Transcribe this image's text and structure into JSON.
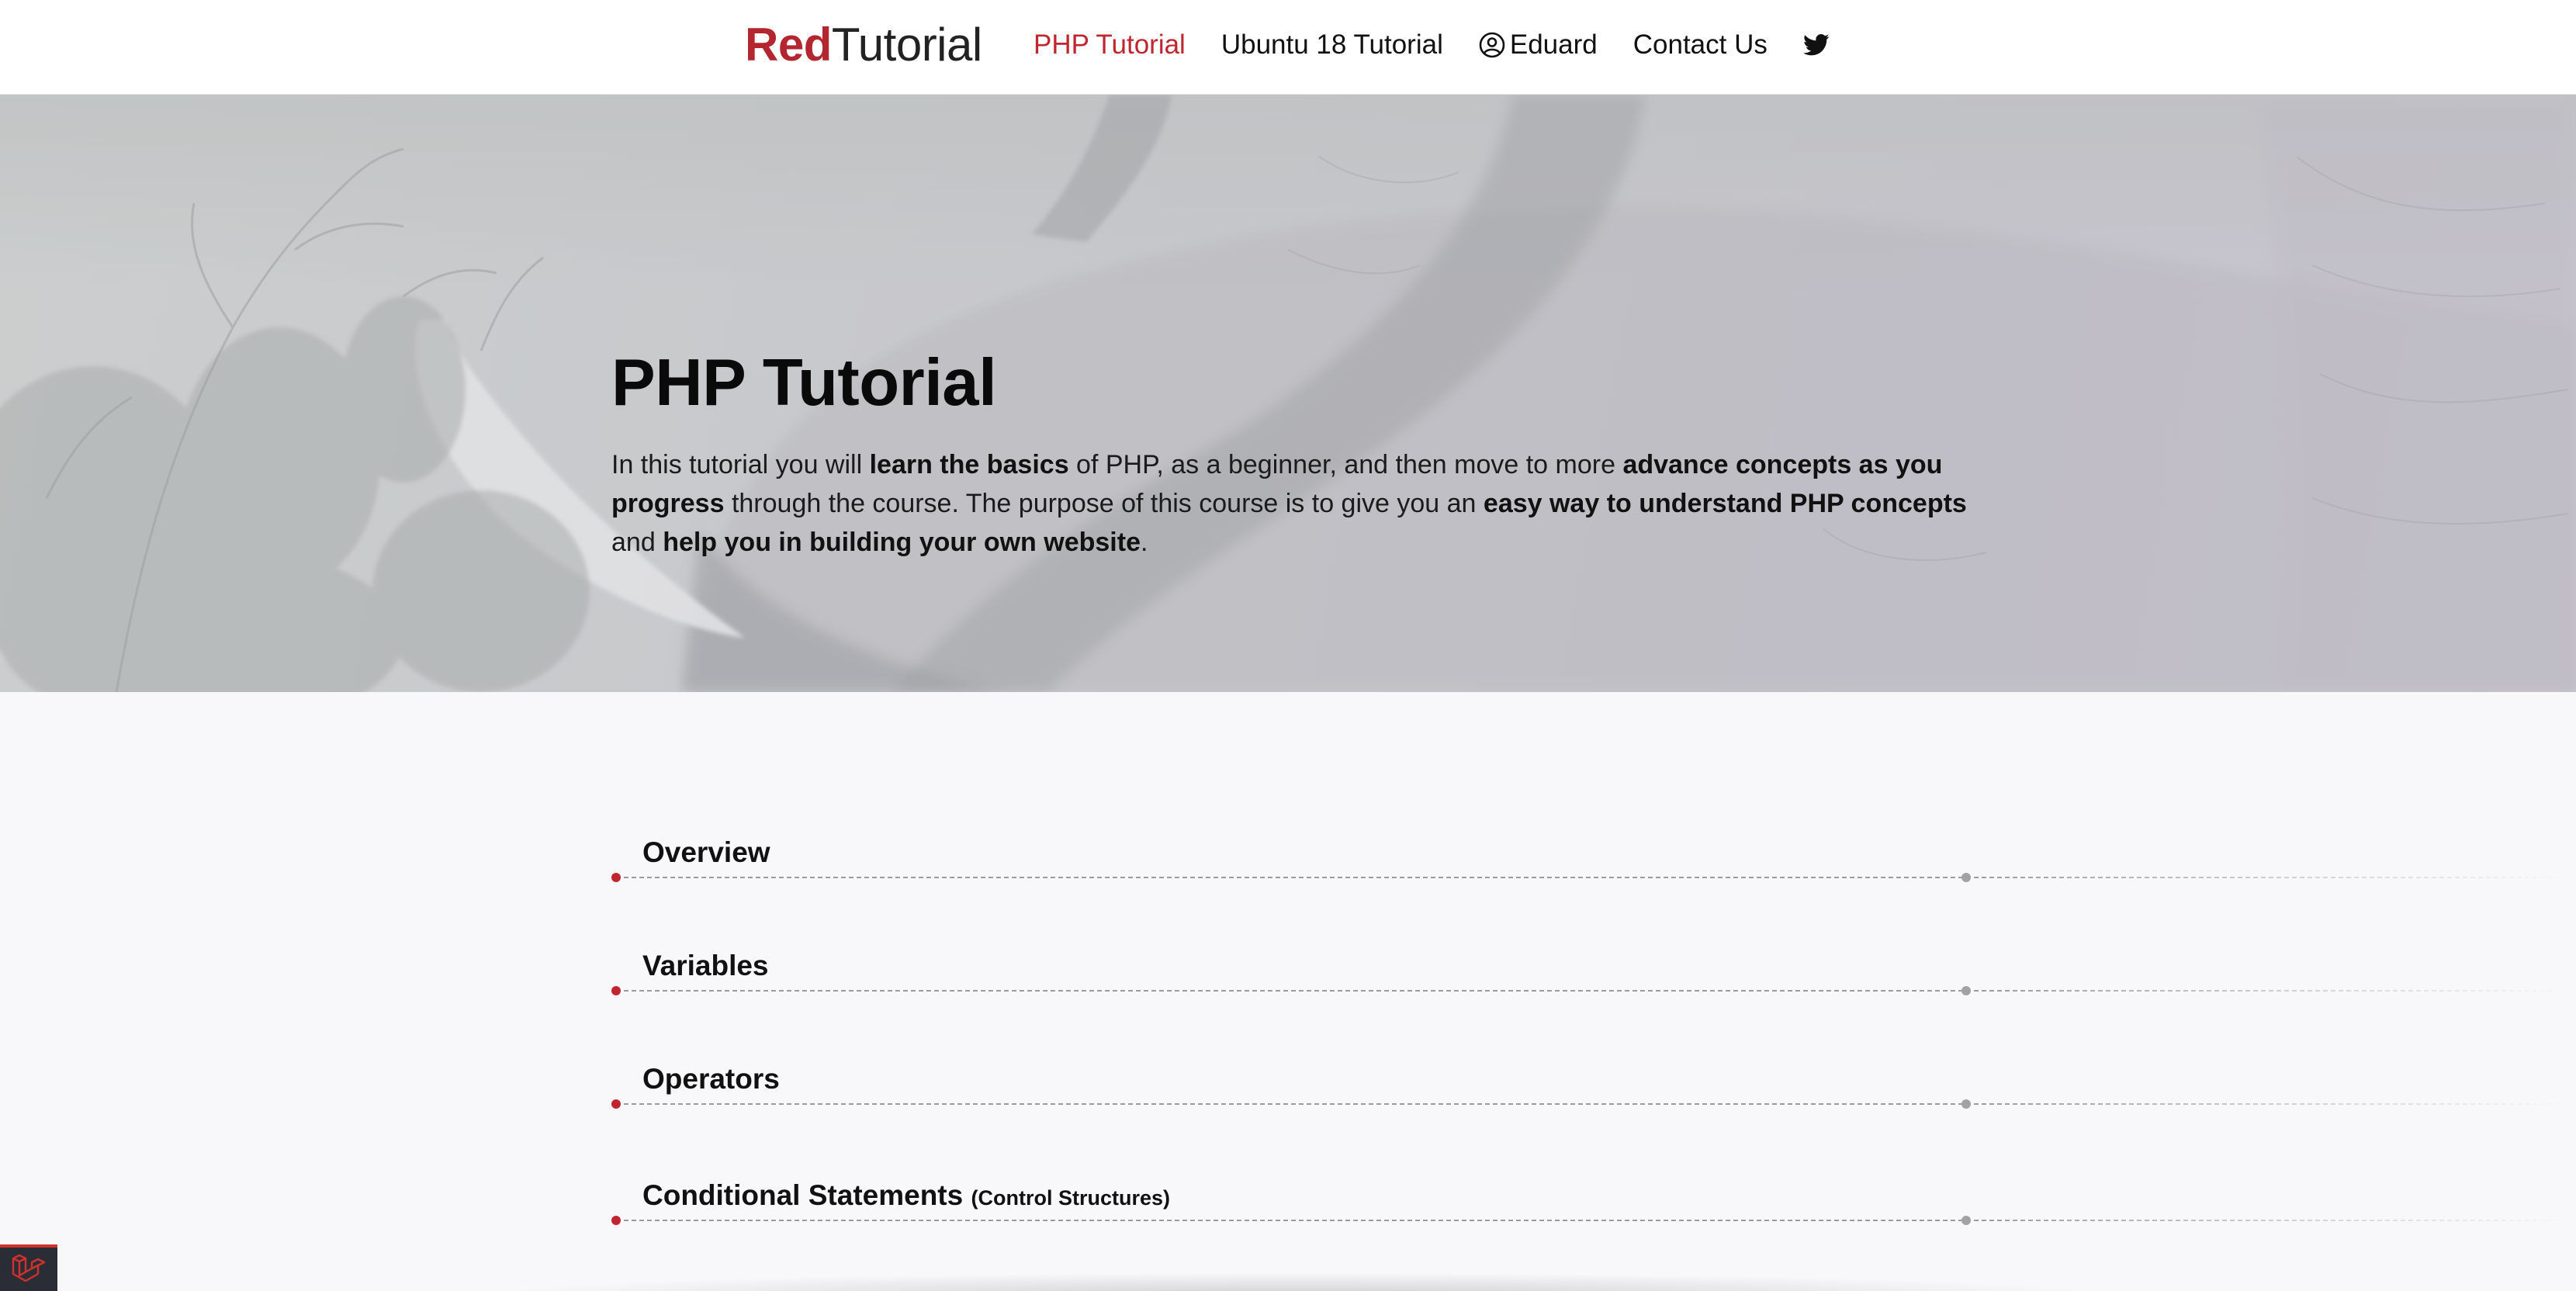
{
  "brand": {
    "part1": "Red",
    "part2": "Tutorial"
  },
  "nav": {
    "items": [
      {
        "label": "PHP Tutorial",
        "active": true
      },
      {
        "label": "Ubuntu 18 Tutorial",
        "active": false
      },
      {
        "label": "Eduard",
        "icon": "user-circle-icon",
        "active": false
      },
      {
        "label": "Contact Us",
        "active": false
      }
    ],
    "social_icon": "twitter-icon"
  },
  "hero": {
    "title": "PHP Tutorial",
    "paragraph": [
      {
        "text": "In this tutorial you will ",
        "bold": false
      },
      {
        "text": "learn the basics",
        "bold": true
      },
      {
        "text": " of PHP, as a beginner, and then move to more ",
        "bold": false
      },
      {
        "text": "advance concepts as you progress",
        "bold": true
      },
      {
        "text": " through the course. The purpose of this course is to give you an ",
        "bold": false
      },
      {
        "text": "easy way to understand PHP concepts",
        "bold": true
      },
      {
        "text": " and ",
        "bold": false
      },
      {
        "text": "help you  in building your own website",
        "bold": true
      },
      {
        "text": ".",
        "bold": false
      }
    ]
  },
  "sections": [
    {
      "title": "Overview",
      "subtitle": ""
    },
    {
      "title": "Variables",
      "subtitle": ""
    },
    {
      "title": "Operators",
      "subtitle": ""
    },
    {
      "title": "Conditional Statements",
      "subtitle": "(Control Structures)"
    }
  ],
  "colors": {
    "accent": "#c0262f",
    "text": "#111111",
    "background": "#f8f8fa",
    "debugbar": "#2a2d36"
  },
  "debugbar": {
    "icon": "laravel-icon"
  }
}
